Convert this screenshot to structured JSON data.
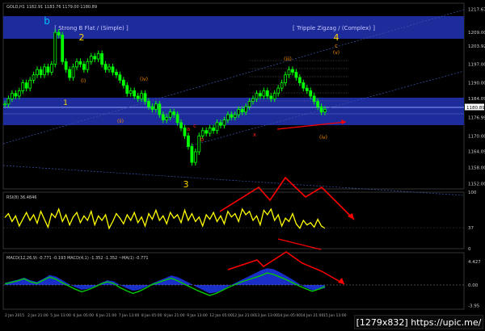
{
  "chart_data": [
    {
      "type": "candlestick",
      "title": "GOLD,H1  1182.91 1183.76 1179.00 1180.89",
      "symbol": "GOLD,H1",
      "ohlc_readout": "1182.91 1183.76 1179.00 1180.89",
      "ylim": [
        1150.0,
        1220.0
      ],
      "y_ticks": [
        "1217.67",
        "1209.00",
        "1203.92",
        "1197.00",
        "1190.00",
        "1184.09",
        "1176.99",
        "1170.00",
        "1164.09",
        "1158.00",
        "1152.00"
      ],
      "last_price_label": "1180.89",
      "x_ticks": [
        "2 Jan 2015",
        "2 Jan 21:00",
        "5 Jan 13:00",
        "6 Jan 05:00",
        "6 Jan 21:00",
        "7 Jan 13:00",
        "8 Jan 05:00",
        "8 Jan 21:00",
        "9 Jan 13:00",
        "12 Jan 05:00",
        "12 Jan 21:00",
        "13 Jan 13:00",
        "14 Jan 05:00",
        "14 Jan 21:00",
        "15 Jan 13:00"
      ],
      "bands": [
        {
          "label": "[ Strong B Flat / (Simple) ]",
          "color": "#1e2b9a"
        },
        {
          "label": "[ Tripple Zigzag / (Complex) ]",
          "color": "#1e2b9a"
        }
      ],
      "price_series": [
        1182,
        1184,
        1186,
        1185,
        1187,
        1190,
        1188,
        1191,
        1193,
        1195,
        1193,
        1196,
        1194,
        1197,
        1209,
        1208,
        1198,
        1195,
        1192,
        1196,
        1198,
        1197,
        1195,
        1198,
        1200,
        1199,
        1201,
        1197,
        1195,
        1196,
        1194,
        1193,
        1191,
        1189,
        1186,
        1187,
        1185,
        1184,
        1186,
        1183,
        1181,
        1180,
        1182,
        1178,
        1176,
        1177,
        1179,
        1178,
        1175,
        1173,
        1170,
        1166,
        1160,
        1164,
        1170,
        1172,
        1171,
        1173,
        1172,
        1175,
        1174,
        1176,
        1178,
        1177,
        1178,
        1180,
        1179,
        1181,
        1183,
        1184,
        1186,
        1185,
        1187,
        1185,
        1184,
        1186,
        1188,
        1190,
        1193,
        1195,
        1194,
        1192,
        1190,
        1188,
        1187,
        1185,
        1183,
        1181,
        1179,
        1180
      ],
      "wave_labels": [
        "b",
        "2",
        "1",
        "(iii)",
        "(iv)",
        "(v)",
        "4",
        "c",
        "3",
        "(i)",
        "(ii)",
        "a",
        "b",
        "c",
        "x",
        "(iv)"
      ],
      "indicator_text": [
        "[ Strong B Flat / (Simple) ]",
        "[ Tripple Zigzag / (Complex) ]"
      ]
    },
    {
      "type": "line",
      "title": "RSI(8) 36.4846",
      "ylim": [
        0,
        100
      ],
      "y_ticks": [
        "100",
        "37",
        "0"
      ],
      "series": [
        {
          "name": "RSI(8)",
          "color": "#ffff00",
          "values": [
            55,
            62,
            48,
            58,
            40,
            52,
            64,
            50,
            60,
            45,
            66,
            52,
            38,
            62,
            55,
            70,
            48,
            60,
            42,
            56,
            64,
            46,
            58,
            50,
            66,
            42,
            58,
            50,
            60,
            36,
            48,
            62,
            54,
            44,
            60,
            50,
            64,
            46,
            56,
            40,
            62,
            52,
            68,
            50,
            58,
            44,
            64,
            54,
            60,
            46,
            68,
            50,
            62,
            48,
            56,
            40,
            60,
            52,
            64,
            48,
            58,
            44,
            66,
            56,
            62,
            48,
            70,
            60,
            66,
            50,
            58,
            42,
            68,
            60,
            70,
            50,
            60,
            40,
            54,
            48,
            62,
            44,
            36,
            50,
            42,
            46,
            38,
            52,
            40,
            36
          ]
        }
      ]
    },
    {
      "type": "area",
      "title": "MACD(12,26,9) -0.771 -0.193  MACD(4,1) -1.352 -1.352  ~MA(1) -0.771",
      "ylim": [
        -5,
        5
      ],
      "y_ticks": [
        "4.427",
        "0.00",
        "-3.95"
      ],
      "series": [
        {
          "name": "MACD(12,26,9)",
          "color": "#00cc00",
          "values": [
            0.2,
            0.5,
            0.8,
            1.2,
            0.6,
            0.3,
            0.9,
            1.5,
            1.1,
            0.4,
            -0.2,
            -0.8,
            -1.3,
            -0.9,
            -0.4,
            0.2,
            0.6,
            0.3,
            -0.5,
            -1.1,
            -1.6,
            -1.2,
            -0.6,
            0.1,
            0.5,
            0.9,
            1.3,
            0.8,
            0.2,
            -0.4,
            -1.0,
            -1.5,
            -2.0,
            -1.6,
            -1.0,
            -0.4,
            0.1,
            0.6,
            1.0,
            1.4,
            1.8,
            2.3,
            2.0,
            1.5,
            1.0,
            0.4,
            -0.2,
            -0.7,
            -1.2,
            -0.8,
            -0.3
          ]
        },
        {
          "name": "MACD(4,1)",
          "color": "#1a2ec8",
          "values": [
            0.4,
            0.7,
            1.0,
            1.4,
            0.9,
            0.6,
            1.2,
            1.9,
            1.6,
            0.9,
            0.2,
            -0.4,
            -0.9,
            -0.7,
            -0.3,
            0.4,
            0.9,
            0.7,
            0.0,
            -0.6,
            -1.1,
            -0.9,
            -0.4,
            0.3,
            0.8,
            1.3,
            1.8,
            1.5,
            0.9,
            0.3,
            -0.4,
            -1.0,
            -1.6,
            -1.4,
            -0.9,
            -0.2,
            0.4,
            1.0,
            1.6,
            2.2,
            2.8,
            3.2,
            3.0,
            2.4,
            1.7,
            1.0,
            0.2,
            -0.5,
            -1.0,
            -0.9,
            -0.6
          ]
        }
      ],
      "macd_readout": "MACD(12,26,9) -0.771 -0.193  MACD(4,1) -1.352 -1.352  ~MA(1) -0.771"
    }
  ],
  "watermark": "[1279x832] https://upic.me/",
  "colors": {
    "background": "#000000",
    "band": "#1e2b9a",
    "candle_up": "#00ff00",
    "candle_down": "#00ff00",
    "wave_yellow": "#ffd700",
    "wave_orange": "#ff8c00",
    "wave_red": "#ff2222",
    "wave_cyan": "#00bfff",
    "rsi_line": "#ffff00",
    "macd_line": "#00cc00",
    "macd_fill": "#1a2ec8",
    "arrow_red": "#ff0000",
    "dotted_trend": "#3a56b0"
  }
}
